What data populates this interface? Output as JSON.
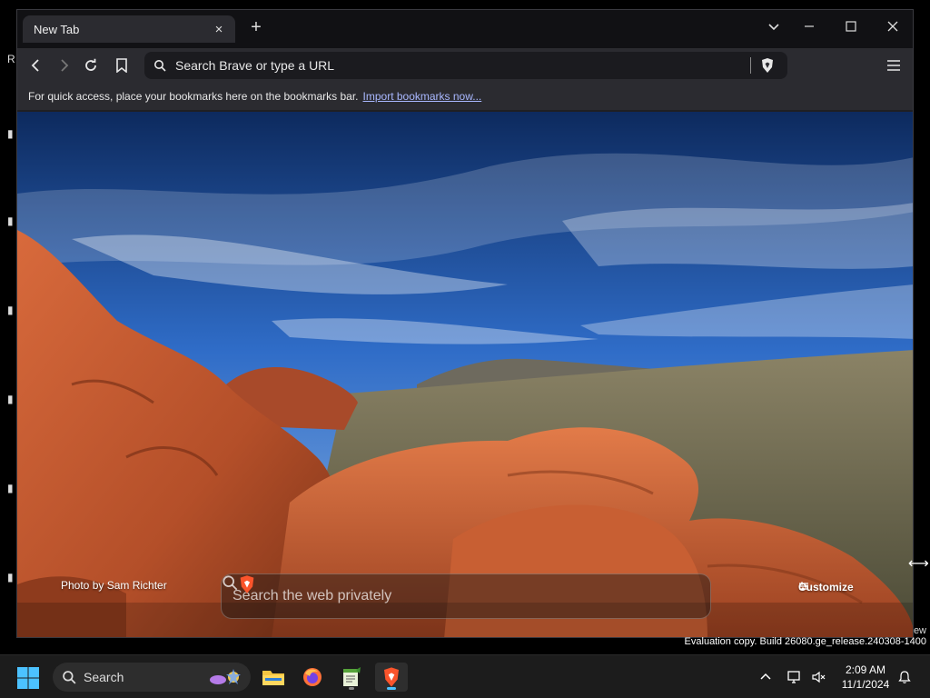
{
  "browser": {
    "tab_title": "New Tab",
    "tab_close_icon": "×",
    "new_tab_icon": "+",
    "omnibox_placeholder": "Search Brave or type a URL",
    "bookmarks_hint": "For quick access, place your bookmarks here on the bookmarks bar.",
    "import_link": "Import bookmarks now..."
  },
  "page": {
    "photo_credit": "Photo by Sam Richter",
    "search_placeholder": "Search the web privately",
    "customize_label": "Customize"
  },
  "system": {
    "eval_text": "Evaluation copy. Build 26080.ge_release.240308-1400",
    "eval_partial": "ew"
  },
  "taskbar": {
    "search_label": "Search",
    "time": "2:09 AM",
    "date": "11/1/2024"
  },
  "colors": {
    "accent": "#4cc2ff",
    "brave_orange": "#fb542b",
    "link": "#a9b8ff"
  }
}
